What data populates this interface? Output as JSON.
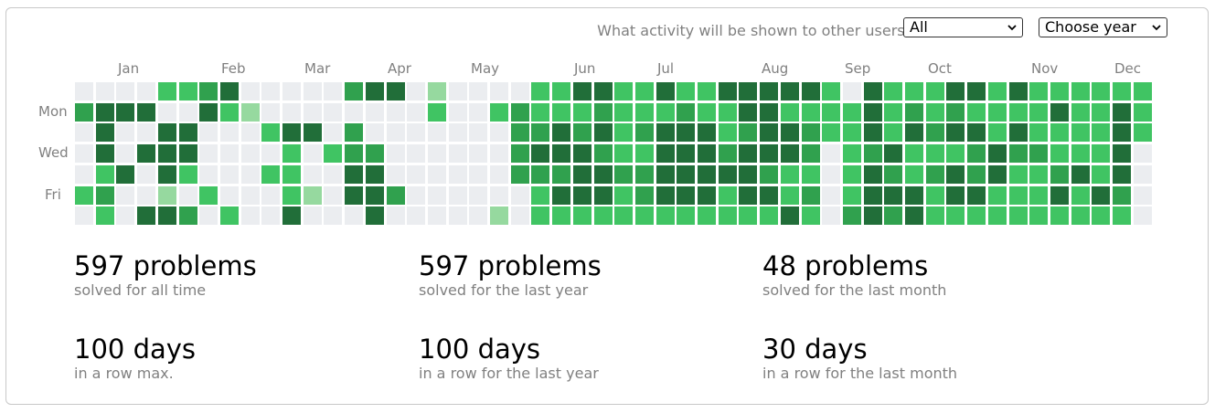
{
  "filters": {
    "activity_label": "What activity will be shown to other users:",
    "activity_value": "All",
    "year_value": "Choose year"
  },
  "calendar": {
    "months": [
      "Jan",
      "Feb",
      "Mar",
      "Apr",
      "May",
      "Jun",
      "Jul",
      "Aug",
      "Sep",
      "Oct",
      "Nov",
      "Dec"
    ],
    "weekday_labels": [
      "Mon",
      "Wed",
      "Fri"
    ],
    "level_colors": [
      "#ebedf0",
      "#96d99f",
      "#40c463",
      "#30a14e",
      "#216e39"
    ],
    "weeks": [
      [
        0,
        3,
        0,
        0,
        0,
        2,
        0
      ],
      [
        0,
        4,
        4,
        4,
        2,
        3,
        2
      ],
      [
        0,
        4,
        0,
        0,
        4,
        0,
        0
      ],
      [
        0,
        4,
        0,
        4,
        0,
        0,
        4
      ],
      [
        2,
        0,
        4,
        4,
        4,
        1,
        4
      ],
      [
        2,
        0,
        4,
        4,
        2,
        0,
        3
      ],
      [
        3,
        4,
        0,
        0,
        0,
        2,
        0
      ],
      [
        4,
        2,
        0,
        0,
        0,
        0,
        2
      ],
      [
        0,
        1,
        0,
        0,
        0,
        0,
        0
      ],
      [
        0,
        0,
        2,
        0,
        2,
        0,
        0
      ],
      [
        0,
        0,
        4,
        2,
        2,
        2,
        4
      ],
      [
        0,
        0,
        4,
        0,
        0,
        1,
        0
      ],
      [
        0,
        0,
        0,
        2,
        0,
        0,
        0
      ],
      [
        3,
        0,
        3,
        3,
        4,
        4,
        0
      ],
      [
        4,
        0,
        0,
        3,
        4,
        4,
        4
      ],
      [
        4,
        0,
        0,
        0,
        0,
        3,
        0
      ],
      [
        0,
        0,
        0,
        0,
        0,
        0,
        0
      ],
      [
        1,
        2,
        0,
        0,
        0,
        0,
        0
      ],
      [
        0,
        0,
        0,
        0,
        0,
        0,
        0
      ],
      [
        0,
        0,
        0,
        0,
        0,
        0,
        0
      ],
      [
        0,
        2,
        0,
        0,
        0,
        0,
        1
      ],
      [
        0,
        3,
        3,
        3,
        3,
        0,
        0
      ],
      [
        2,
        2,
        3,
        4,
        3,
        2,
        2
      ],
      [
        2,
        2,
        4,
        4,
        3,
        4,
        2
      ],
      [
        4,
        2,
        3,
        4,
        4,
        4,
        2
      ],
      [
        4,
        3,
        4,
        3,
        4,
        4,
        2
      ],
      [
        2,
        2,
        2,
        2,
        3,
        2,
        2
      ],
      [
        2,
        2,
        3,
        2,
        3,
        3,
        2
      ],
      [
        4,
        2,
        4,
        4,
        4,
        4,
        2
      ],
      [
        2,
        3,
        4,
        4,
        4,
        4,
        2
      ],
      [
        2,
        2,
        4,
        4,
        4,
        4,
        2
      ],
      [
        4,
        2,
        2,
        3,
        4,
        2,
        2
      ],
      [
        4,
        4,
        3,
        4,
        4,
        4,
        2
      ],
      [
        4,
        4,
        4,
        4,
        3,
        4,
        2
      ],
      [
        4,
        2,
        4,
        4,
        2,
        2,
        4
      ],
      [
        4,
        2,
        3,
        3,
        2,
        3,
        2
      ],
      [
        2,
        2,
        2,
        0,
        0,
        0,
        0
      ],
      [
        0,
        2,
        2,
        2,
        2,
        2,
        3
      ],
      [
        4,
        4,
        4,
        3,
        4,
        4,
        4
      ],
      [
        2,
        2,
        2,
        4,
        3,
        4,
        3
      ],
      [
        2,
        3,
        4,
        2,
        2,
        4,
        4
      ],
      [
        2,
        2,
        3,
        2,
        3,
        2,
        2
      ],
      [
        4,
        3,
        4,
        2,
        4,
        4,
        2
      ],
      [
        4,
        2,
        4,
        3,
        3,
        4,
        2
      ],
      [
        2,
        2,
        2,
        4,
        4,
        2,
        2
      ],
      [
        4,
        2,
        4,
        3,
        2,
        2,
        2
      ],
      [
        2,
        2,
        2,
        3,
        2,
        2,
        2
      ],
      [
        2,
        4,
        2,
        2,
        3,
        4,
        2
      ],
      [
        2,
        2,
        2,
        2,
        4,
        2,
        2
      ],
      [
        2,
        2,
        2,
        2,
        2,
        4,
        2
      ],
      [
        2,
        4,
        4,
        4,
        4,
        3,
        2
      ],
      [
        2,
        2,
        2,
        0,
        0,
        0,
        0
      ]
    ]
  },
  "stats": [
    {
      "value": "597 problems",
      "caption": "solved for all time"
    },
    {
      "value": "597 problems",
      "caption": "solved for the last year"
    },
    {
      "value": "48 problems",
      "caption": "solved for the last month"
    },
    {
      "value": "100 days",
      "caption": "in a row max."
    },
    {
      "value": "100 days",
      "caption": "in a row for the last year"
    },
    {
      "value": "30 days",
      "caption": "in a row for the last month"
    }
  ]
}
